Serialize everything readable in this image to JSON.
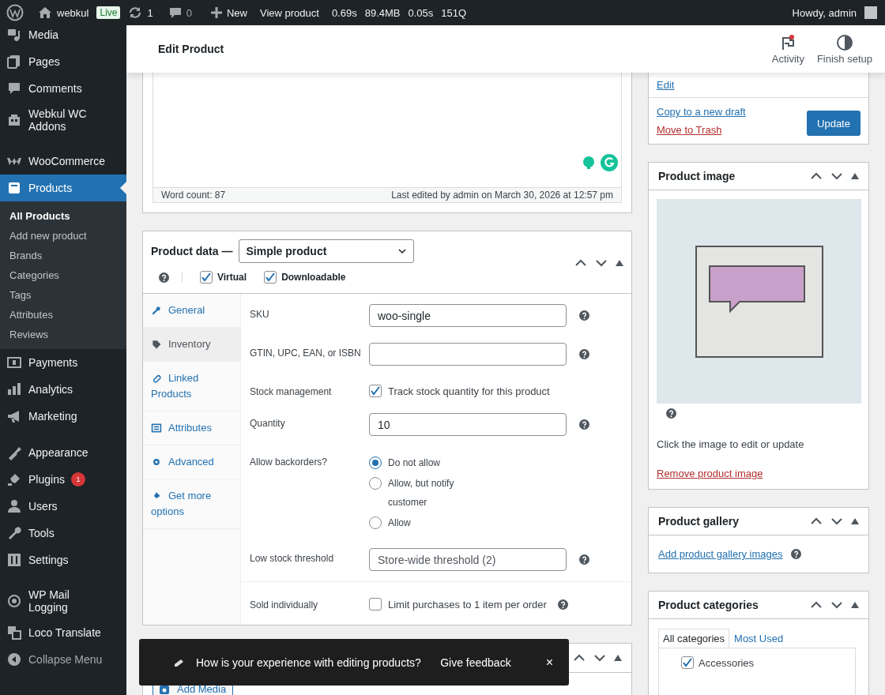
{
  "admin_bar": {
    "site": "webkul",
    "live_badge": "Live",
    "updates": "1",
    "comments": "0",
    "new": "New",
    "view": "View product",
    "stats": [
      "0.69s",
      "89.4MB",
      "0.05s",
      "151Q"
    ],
    "greeting": "Howdy, admin"
  },
  "sidebar": {
    "groups": [
      [
        {
          "label": "Media",
          "selected": false
        },
        {
          "label": "Pages",
          "selected": false
        },
        {
          "label": "Comments",
          "selected": false
        },
        {
          "label": "Webkul WC Addons",
          "selected": false
        }
      ],
      [
        {
          "label": "WooCommerce",
          "selected": false
        },
        {
          "label": "Products",
          "selected": true,
          "submenu": [
            {
              "label": "All Products",
              "selected": true
            },
            {
              "label": "Add new product",
              "selected": false
            },
            {
              "label": "Brands",
              "selected": false
            },
            {
              "label": "Categories",
              "selected": false
            },
            {
              "label": "Tags",
              "selected": false
            },
            {
              "label": "Attributes",
              "selected": false
            },
            {
              "label": "Reviews",
              "selected": false
            }
          ]
        },
        {
          "label": "Payments",
          "selected": false
        },
        {
          "label": "Analytics",
          "selected": false
        },
        {
          "label": "Marketing",
          "selected": false
        }
      ],
      [
        {
          "label": "Appearance",
          "selected": false
        },
        {
          "label": "Plugins",
          "selected": false,
          "badge": "1"
        },
        {
          "label": "Users",
          "selected": false
        },
        {
          "label": "Tools",
          "selected": false
        },
        {
          "label": "Settings",
          "selected": false
        }
      ],
      [
        {
          "label": "WP Mail Logging",
          "selected": false
        },
        {
          "label": "Loco Translate",
          "selected": false
        }
      ]
    ],
    "collapse": "Collapse Menu"
  },
  "header": {
    "title": "Edit Product",
    "actions": [
      {
        "label": "Activity",
        "notification": true
      },
      {
        "label": "Finish setup",
        "notification": false
      }
    ]
  },
  "editor": {
    "word_count": "Word count: 87",
    "last_edited": "Last edited by admin on March 30, 2026 at 12:57 pm"
  },
  "product_data": {
    "title": "Product data —",
    "type_select": "Simple product",
    "options": [
      {
        "label": "Virtual",
        "checked": true
      },
      {
        "label": "Downloadable",
        "checked": true
      }
    ],
    "tabs": [
      {
        "label": "General",
        "selected": false
      },
      {
        "label": "Inventory",
        "selected": true
      },
      {
        "label": "Linked Products",
        "selected": false
      },
      {
        "label": "Attributes",
        "selected": false
      },
      {
        "label": "Advanced",
        "selected": false
      },
      {
        "label": "Get more options",
        "selected": false
      }
    ],
    "field_groups": [
      [
        {
          "kind": "text",
          "label": "SKU",
          "value": "woo-single",
          "help": true
        },
        {
          "kind": "text",
          "label": "GTIN, UPC, EAN, or ISBN",
          "help": true
        },
        {
          "kind": "checkbox",
          "label": "Stock management",
          "option": "Track stock quantity for this product",
          "checked": true
        },
        {
          "kind": "text",
          "label": "Quantity",
          "value": "10",
          "help": true
        },
        {
          "kind": "radio",
          "label": "Allow backorders?",
          "options": [
            {
              "label": "Do not allow",
              "selected": true
            },
            {
              "label": "Allow, but notify customer",
              "selected": false
            },
            {
              "label": "Allow",
              "selected": false
            }
          ]
        },
        {
          "kind": "text",
          "label": "Low stock threshold",
          "placeholder": "Store-wide threshold (2)",
          "help": true
        }
      ],
      [
        {
          "kind": "checkbox",
          "label": "Sold individually",
          "option": "Limit purchases to 1 item per order",
          "checked": false,
          "help": true
        }
      ]
    ]
  },
  "description": {
    "add_media": "Add Media"
  },
  "toast": {
    "message": "How is your experience with editing products?",
    "action": "Give feedback",
    "close": "×"
  },
  "publish": {
    "edit_link": "Edit",
    "copy_link": "Copy to a new draft",
    "trash_link": "Move to Trash",
    "button": "Update"
  },
  "product_image": {
    "title": "Product image",
    "hint": "Click the image to edit or update",
    "remove_link": "Remove product image"
  },
  "product_gallery": {
    "title": "Product gallery",
    "link": "Add product gallery images"
  },
  "product_categories": {
    "title": "Product categories",
    "tabs": [
      {
        "label": "All categories",
        "selected": true
      },
      {
        "label": "Most Used",
        "selected": false
      }
    ],
    "items": [
      {
        "label": "Accessories",
        "checked": true
      }
    ]
  }
}
